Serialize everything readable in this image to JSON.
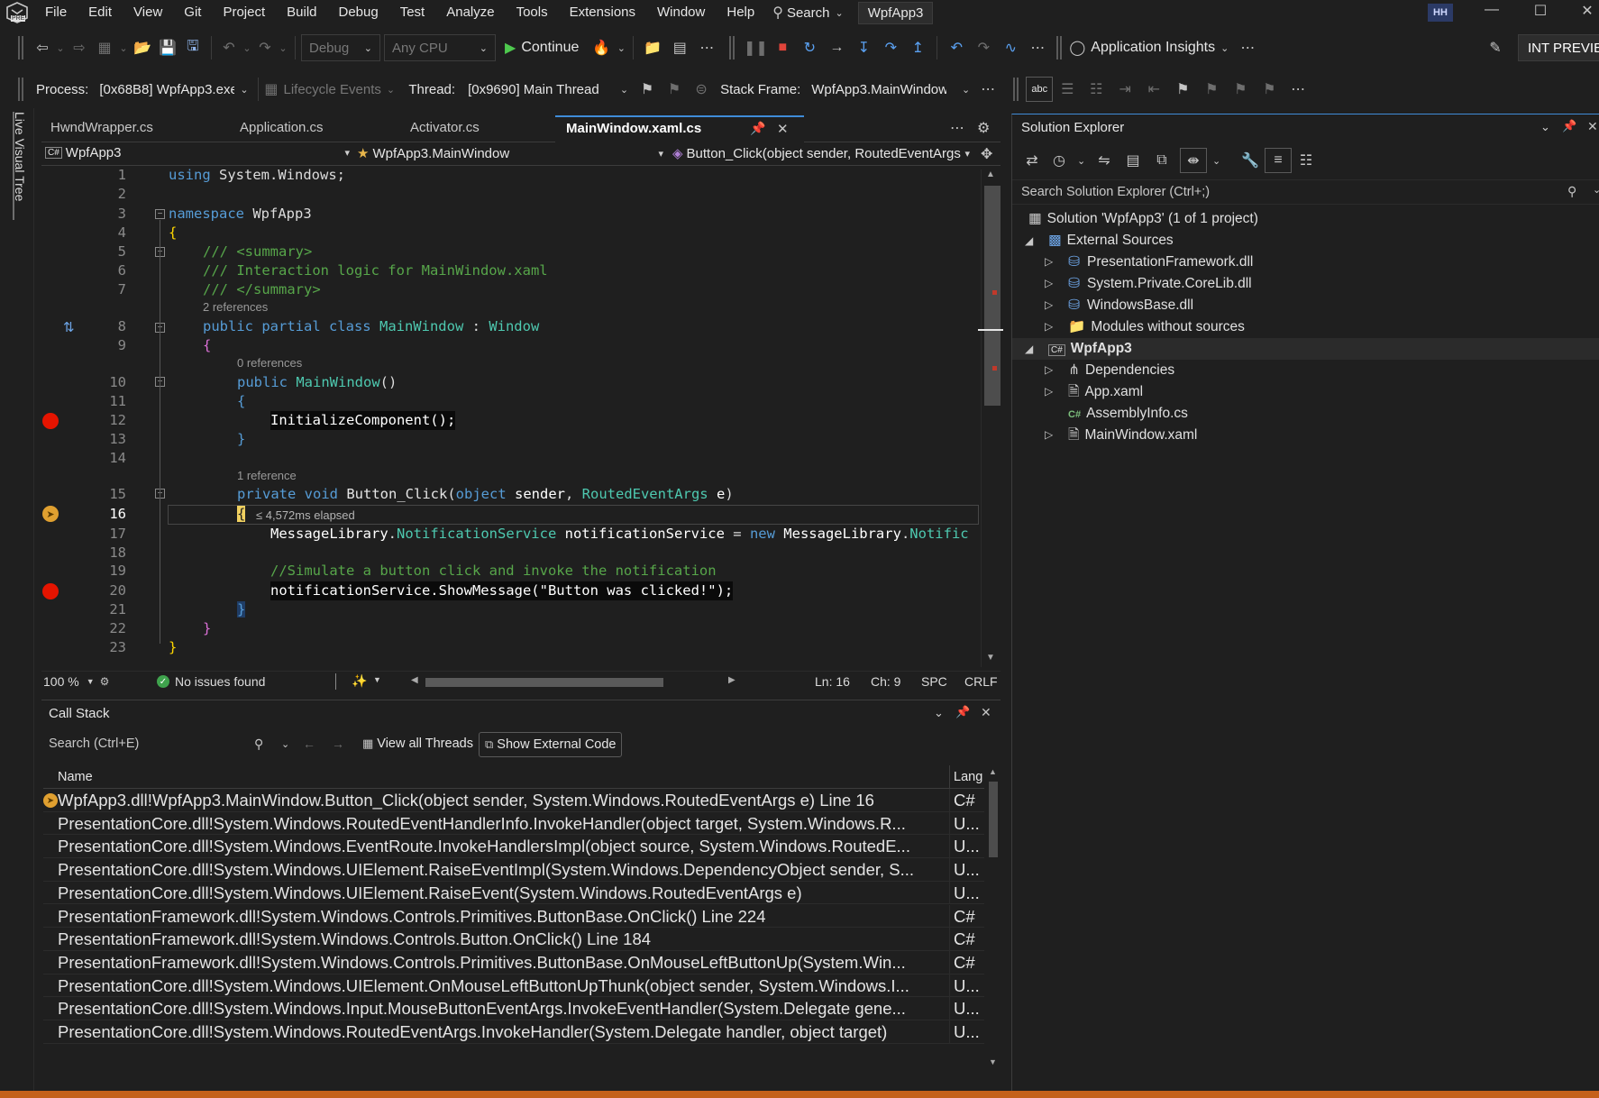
{
  "menubar": {
    "items": [
      "File",
      "Edit",
      "View",
      "Git",
      "Project",
      "Build",
      "Debug",
      "Test",
      "Analyze",
      "Tools",
      "Extensions",
      "Window",
      "Help"
    ],
    "search_label": "Search",
    "solution_name": "WpfApp3",
    "user_initials": "HH",
    "logo_badge": "PRE"
  },
  "toolbar": {
    "config": "Debug",
    "platform": "Any CPU",
    "continue_label": "Continue",
    "insights_label": "Application Insights",
    "preview_label": "INT PREVIEW"
  },
  "debug_location": {
    "process_label": "Process:",
    "process_value": "[0x68B8] WpfApp3.exe",
    "lifecycle_label": "Lifecycle Events",
    "thread_label": "Thread:",
    "thread_value": "[0x9690] Main Thread",
    "stack_frame_label": "Stack Frame:",
    "stack_frame_value": "WpfApp3.MainWindow",
    "abc": "abc"
  },
  "side_tab": "Live Visual Tree",
  "editor": {
    "tabs": [
      "HwndWrapper.cs",
      "Application.cs",
      "Activator.cs",
      "MainWindow.xaml.cs"
    ],
    "active_tab": "MainWindow.xaml.cs",
    "nav_project": "WpfApp3",
    "nav_class": "WpfApp3.MainWindow",
    "nav_member": "Button_Click(object sender, RoutedEventArgs",
    "line_numbers": [
      "1",
      "2",
      "3",
      "4",
      "5",
      "6",
      "7",
      "8",
      "9",
      "10",
      "11",
      "12",
      "13",
      "14",
      "15",
      "16",
      "17",
      "18",
      "19",
      "20",
      "21",
      "22",
      "23"
    ],
    "codelens": {
      "class_refs": "2 references",
      "ctor_refs": "0 references",
      "method_refs": "1 reference",
      "elapsed": "≤ 4,572ms elapsed"
    },
    "code": {
      "l1_kw": "using",
      "l1_rest": " System.Windows;",
      "l3_kw": "namespace",
      "l3_rest": " WpfApp3",
      "l4": "{",
      "l5": "/// <summary>",
      "l6": "/// Interaction logic for MainWindow.xaml",
      "l7": "/// </summary>",
      "l8_kw": "public partial class",
      "l8_type": "MainWindow",
      "l8_colon": " : ",
      "l8_base": "Window",
      "l9": "{",
      "l10_kw": "public",
      "l10_name": "MainWindow",
      "l10_paren": "()",
      "l11": "{",
      "l12": "InitializeComponent();",
      "l13": "}",
      "l15_kw": "private void",
      "l15_name": "Button_Click",
      "l15_p1": "(",
      "l15_t1": "object",
      "l15_a1": " sender",
      "l15_c": ", ",
      "l15_t2": "RoutedEventArgs",
      "l15_a2": " e",
      "l15_p2": ")",
      "l16": "{",
      "l17_ns": "MessageLibrary",
      "l17_dot": ".",
      "l17_type": "NotificationService",
      "l17_var": " notificationService",
      "l17_eq": " = ",
      "l17_new": "new",
      "l17_ns2": " MessageLibrary",
      "l17_dot2": ".",
      "l17_type2": "Notific",
      "l19": "//Simulate a button click and invoke the notification",
      "l20": "notificationService.ShowMessage(\"Button was clicked!\");",
      "l21": "}",
      "l22": "}",
      "l23": "}"
    },
    "status": {
      "zoom": "100 %",
      "issues": "No issues found",
      "ln": "Ln: 16",
      "ch": "Ch: 9",
      "spc": "SPC",
      "crlf": "CRLF"
    }
  },
  "call_stack": {
    "title": "Call Stack",
    "search_placeholder": "Search (Ctrl+E)",
    "view_threads": "View all Threads",
    "show_external": "Show External Code",
    "col_name": "Name",
    "col_lang": "Lang",
    "rows": [
      {
        "name": "WpfApp3.dll!WpfApp3.MainWindow.Button_Click(object sender, System.Windows.RoutedEventArgs e) Line 16",
        "lang": "C#"
      },
      {
        "name": "PresentationCore.dll!System.Windows.RoutedEventHandlerInfo.InvokeHandler(object target, System.Windows.R...",
        "lang": "U..."
      },
      {
        "name": "PresentationCore.dll!System.Windows.EventRoute.InvokeHandlersImpl(object source, System.Windows.RoutedE...",
        "lang": "U..."
      },
      {
        "name": "PresentationCore.dll!System.Windows.UIElement.RaiseEventImpl(System.Windows.DependencyObject sender, S...",
        "lang": "U..."
      },
      {
        "name": "PresentationCore.dll!System.Windows.UIElement.RaiseEvent(System.Windows.RoutedEventArgs e)",
        "lang": "U..."
      },
      {
        "name": "PresentationFramework.dll!System.Windows.Controls.Primitives.ButtonBase.OnClick() Line 224",
        "lang": "C#"
      },
      {
        "name": "PresentationFramework.dll!System.Windows.Controls.Button.OnClick() Line 184",
        "lang": "C#"
      },
      {
        "name": "PresentationFramework.dll!System.Windows.Controls.Primitives.ButtonBase.OnMouseLeftButtonUp(System.Win...",
        "lang": "C#"
      },
      {
        "name": "PresentationCore.dll!System.Windows.UIElement.OnMouseLeftButtonUpThunk(object sender, System.Windows.I...",
        "lang": "U..."
      },
      {
        "name": "PresentationCore.dll!System.Windows.Input.MouseButtonEventArgs.InvokeEventHandler(System.Delegate gene...",
        "lang": "U..."
      },
      {
        "name": "PresentationCore.dll!System.Windows.RoutedEventArgs.InvokeHandler(System.Delegate handler, object target)",
        "lang": "U..."
      }
    ]
  },
  "solution_explorer": {
    "title": "Solution Explorer",
    "search_placeholder": "Search Solution Explorer (Ctrl+;)",
    "solution": "Solution 'WpfApp3' (1 of 1 project)",
    "external_sources": "External Sources",
    "ext_items": [
      "PresentationFramework.dll",
      "System.Private.CoreLib.dll",
      "WindowsBase.dll",
      "Modules without sources"
    ],
    "project": "WpfApp3",
    "project_items": [
      "Dependencies",
      "App.xaml",
      "AssemblyInfo.cs",
      "MainWindow.xaml"
    ]
  }
}
